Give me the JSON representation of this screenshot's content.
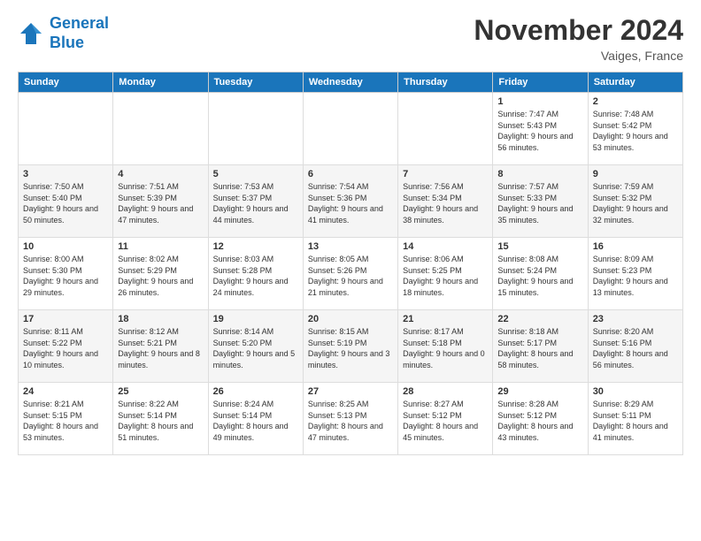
{
  "header": {
    "logo_line1": "General",
    "logo_line2": "Blue",
    "month_title": "November 2024",
    "location": "Vaiges, France"
  },
  "days_of_week": [
    "Sunday",
    "Monday",
    "Tuesday",
    "Wednesday",
    "Thursday",
    "Friday",
    "Saturday"
  ],
  "weeks": [
    [
      {
        "day": "",
        "info": ""
      },
      {
        "day": "",
        "info": ""
      },
      {
        "day": "",
        "info": ""
      },
      {
        "day": "",
        "info": ""
      },
      {
        "day": "",
        "info": ""
      },
      {
        "day": "1",
        "info": "Sunrise: 7:47 AM\nSunset: 5:43 PM\nDaylight: 9 hours and 56 minutes."
      },
      {
        "day": "2",
        "info": "Sunrise: 7:48 AM\nSunset: 5:42 PM\nDaylight: 9 hours and 53 minutes."
      }
    ],
    [
      {
        "day": "3",
        "info": "Sunrise: 7:50 AM\nSunset: 5:40 PM\nDaylight: 9 hours and 50 minutes."
      },
      {
        "day": "4",
        "info": "Sunrise: 7:51 AM\nSunset: 5:39 PM\nDaylight: 9 hours and 47 minutes."
      },
      {
        "day": "5",
        "info": "Sunrise: 7:53 AM\nSunset: 5:37 PM\nDaylight: 9 hours and 44 minutes."
      },
      {
        "day": "6",
        "info": "Sunrise: 7:54 AM\nSunset: 5:36 PM\nDaylight: 9 hours and 41 minutes."
      },
      {
        "day": "7",
        "info": "Sunrise: 7:56 AM\nSunset: 5:34 PM\nDaylight: 9 hours and 38 minutes."
      },
      {
        "day": "8",
        "info": "Sunrise: 7:57 AM\nSunset: 5:33 PM\nDaylight: 9 hours and 35 minutes."
      },
      {
        "day": "9",
        "info": "Sunrise: 7:59 AM\nSunset: 5:32 PM\nDaylight: 9 hours and 32 minutes."
      }
    ],
    [
      {
        "day": "10",
        "info": "Sunrise: 8:00 AM\nSunset: 5:30 PM\nDaylight: 9 hours and 29 minutes."
      },
      {
        "day": "11",
        "info": "Sunrise: 8:02 AM\nSunset: 5:29 PM\nDaylight: 9 hours and 26 minutes."
      },
      {
        "day": "12",
        "info": "Sunrise: 8:03 AM\nSunset: 5:28 PM\nDaylight: 9 hours and 24 minutes."
      },
      {
        "day": "13",
        "info": "Sunrise: 8:05 AM\nSunset: 5:26 PM\nDaylight: 9 hours and 21 minutes."
      },
      {
        "day": "14",
        "info": "Sunrise: 8:06 AM\nSunset: 5:25 PM\nDaylight: 9 hours and 18 minutes."
      },
      {
        "day": "15",
        "info": "Sunrise: 8:08 AM\nSunset: 5:24 PM\nDaylight: 9 hours and 15 minutes."
      },
      {
        "day": "16",
        "info": "Sunrise: 8:09 AM\nSunset: 5:23 PM\nDaylight: 9 hours and 13 minutes."
      }
    ],
    [
      {
        "day": "17",
        "info": "Sunrise: 8:11 AM\nSunset: 5:22 PM\nDaylight: 9 hours and 10 minutes."
      },
      {
        "day": "18",
        "info": "Sunrise: 8:12 AM\nSunset: 5:21 PM\nDaylight: 9 hours and 8 minutes."
      },
      {
        "day": "19",
        "info": "Sunrise: 8:14 AM\nSunset: 5:20 PM\nDaylight: 9 hours and 5 minutes."
      },
      {
        "day": "20",
        "info": "Sunrise: 8:15 AM\nSunset: 5:19 PM\nDaylight: 9 hours and 3 minutes."
      },
      {
        "day": "21",
        "info": "Sunrise: 8:17 AM\nSunset: 5:18 PM\nDaylight: 9 hours and 0 minutes."
      },
      {
        "day": "22",
        "info": "Sunrise: 8:18 AM\nSunset: 5:17 PM\nDaylight: 8 hours and 58 minutes."
      },
      {
        "day": "23",
        "info": "Sunrise: 8:20 AM\nSunset: 5:16 PM\nDaylight: 8 hours and 56 minutes."
      }
    ],
    [
      {
        "day": "24",
        "info": "Sunrise: 8:21 AM\nSunset: 5:15 PM\nDaylight: 8 hours and 53 minutes."
      },
      {
        "day": "25",
        "info": "Sunrise: 8:22 AM\nSunset: 5:14 PM\nDaylight: 8 hours and 51 minutes."
      },
      {
        "day": "26",
        "info": "Sunrise: 8:24 AM\nSunset: 5:14 PM\nDaylight: 8 hours and 49 minutes."
      },
      {
        "day": "27",
        "info": "Sunrise: 8:25 AM\nSunset: 5:13 PM\nDaylight: 8 hours and 47 minutes."
      },
      {
        "day": "28",
        "info": "Sunrise: 8:27 AM\nSunset: 5:12 PM\nDaylight: 8 hours and 45 minutes."
      },
      {
        "day": "29",
        "info": "Sunrise: 8:28 AM\nSunset: 5:12 PM\nDaylight: 8 hours and 43 minutes."
      },
      {
        "day": "30",
        "info": "Sunrise: 8:29 AM\nSunset: 5:11 PM\nDaylight: 8 hours and 41 minutes."
      }
    ]
  ]
}
